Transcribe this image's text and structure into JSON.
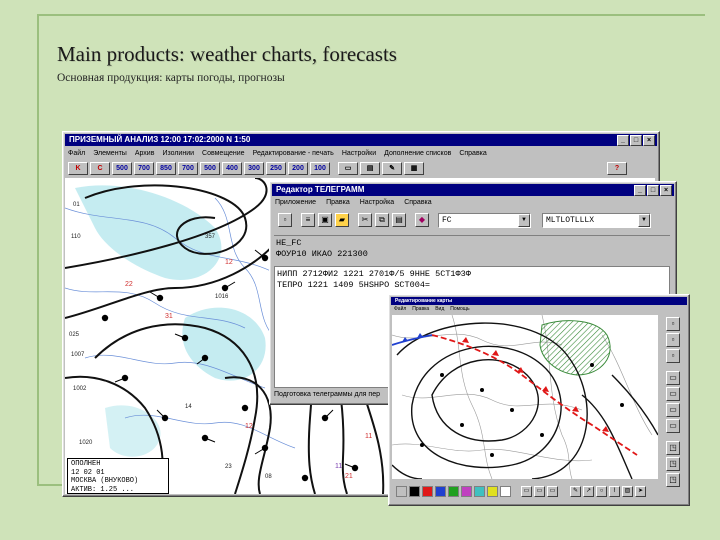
{
  "slide": {
    "title": "Main products: weather charts, forecasts",
    "subtitle": "Основная продукция: карты погоды, прогнозы"
  },
  "main_window": {
    "title": "ПРИЗЕМНЫЙ АНАЛИЗ    12:00    17:02:2000    N  1:50",
    "menu": [
      "Файл",
      "Элементы",
      "Архив",
      "Изолинии",
      "Совмещение",
      "Редактирование - печать",
      "Настройки",
      "Дополнение списков",
      "Справка"
    ],
    "toolbar": [
      "K",
      "C",
      "500",
      "700",
      "850",
      "700",
      "500",
      "400",
      "300",
      "250",
      "200",
      "100"
    ],
    "help_button": "?",
    "legend_lines": [
      "ОПОЛНЕН",
      "12  02  01",
      "МОСКВА (ВНУКОВО)",
      "АКТИВ: 1.25 ..."
    ]
  },
  "telegram_window": {
    "title": "Редактор ТЕЛЕГРАММ",
    "menu": [
      "Приложение",
      "Правка",
      "Настройка",
      "Справка"
    ],
    "combo1": "FC",
    "combo2": "MLTLOTLLLX",
    "header_lines": [
      "HE_FC",
      "ФОУР10 ИКАО 221300"
    ],
    "body_lines": [
      "НИПП 2712ФИ2 1221 2701Ф/5 9ННЕ 5СТ1Ф3Ф",
      "ТЕПРО 1221 1409 5НSНРО SCT004="
    ],
    "status": "Подготовка телеграммы для пер"
  },
  "forecast_window": {
    "title": "Редактирование карты",
    "menu": [
      "Файл",
      "Правка",
      "Вид",
      "Помощь"
    ]
  },
  "colors": {
    "background": "#cfe3b9",
    "titlebar": "#000080",
    "window": "#c0c0c0"
  }
}
